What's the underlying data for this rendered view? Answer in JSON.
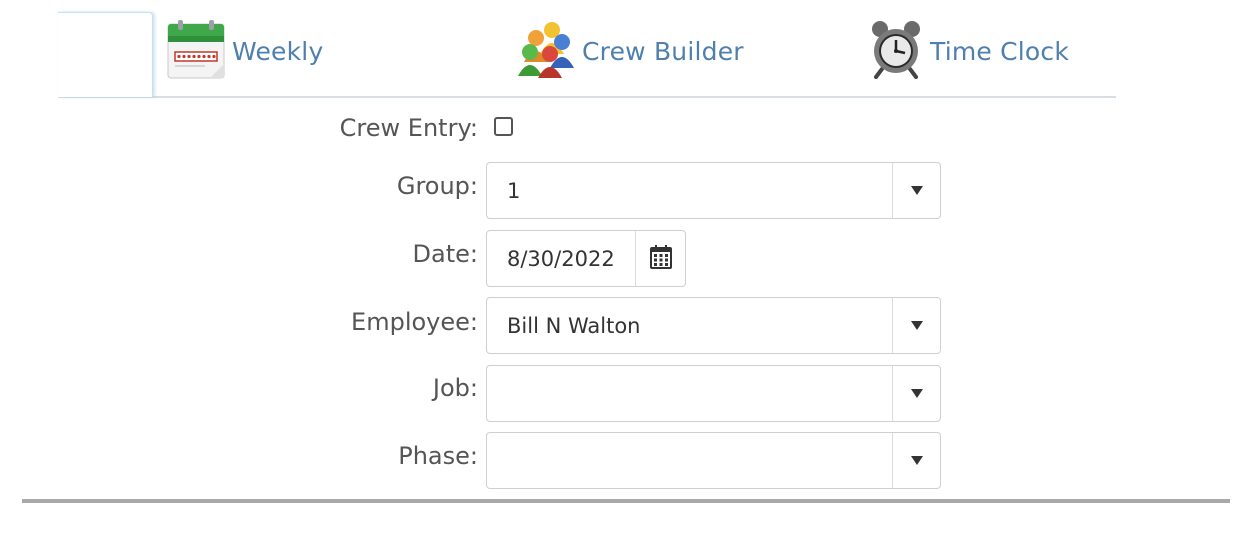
{
  "tabs": [
    {
      "label": "Weekly",
      "icon": "calendar-icon"
    },
    {
      "label": "Crew Builder",
      "icon": "people-group-icon"
    },
    {
      "label": "Time Clock",
      "icon": "alarm-clock-icon"
    }
  ],
  "form": {
    "crew_entry": {
      "label": "Crew Entry:",
      "checked": false
    },
    "group": {
      "label": "Group:",
      "value": "1"
    },
    "date": {
      "label": "Date:",
      "value": "8/30/2022",
      "icon": "calendar-grid-icon"
    },
    "employee": {
      "label": "Employee:",
      "value": "Bill N Walton"
    },
    "job": {
      "label": "Job:",
      "value": ""
    },
    "phase": {
      "label": "Phase:",
      "value": ""
    }
  },
  "colors": {
    "tab_text": "#4f7fae",
    "label_text": "#555555",
    "field_border": "#cfcfcf",
    "rule": "#a9a9a9"
  }
}
